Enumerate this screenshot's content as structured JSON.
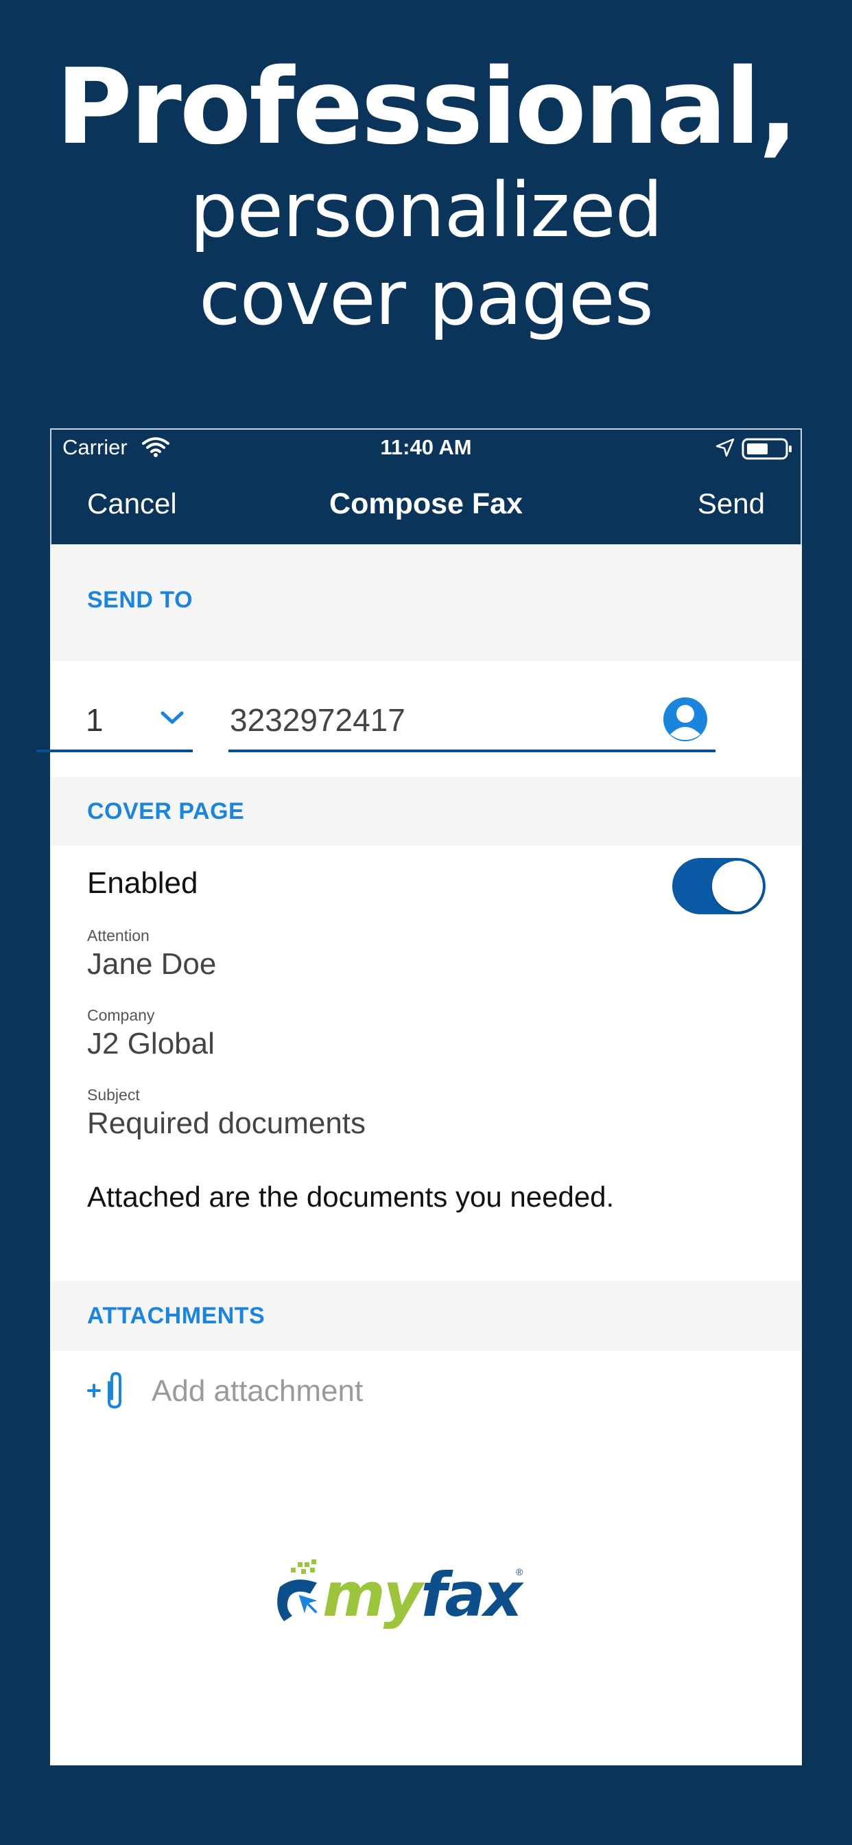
{
  "headline": {
    "line1": "Professional,",
    "line2": "personalized",
    "line3": "cover pages"
  },
  "status_bar": {
    "carrier": "Carrier",
    "time": "11:40 AM"
  },
  "nav": {
    "cancel": "Cancel",
    "title": "Compose Fax",
    "send": "Send"
  },
  "send_to": {
    "header": "SEND TO",
    "country_code": "1",
    "fax_number": "3232972417"
  },
  "cover_page": {
    "header": "COVER PAGE",
    "enabled_label": "Enabled",
    "enabled": true,
    "attention_label": "Attention",
    "attention_value": "Jane Doe",
    "company_label": "Company",
    "company_value": "J2 Global",
    "subject_label": "Subject",
    "subject_value": "Required documents",
    "message": "Attached are the documents you needed."
  },
  "attachments": {
    "header": "ATTACHMENTS",
    "add_label": "Add attachment"
  },
  "logo": {
    "my": "my",
    "fax": "fax",
    "reg": "®"
  },
  "colors": {
    "background": "#0a3459",
    "accent": "#1b84dc",
    "toggle_on": "#0a5aa6",
    "logo_green": "#9cc43c",
    "logo_blue": "#0d4f8a"
  }
}
